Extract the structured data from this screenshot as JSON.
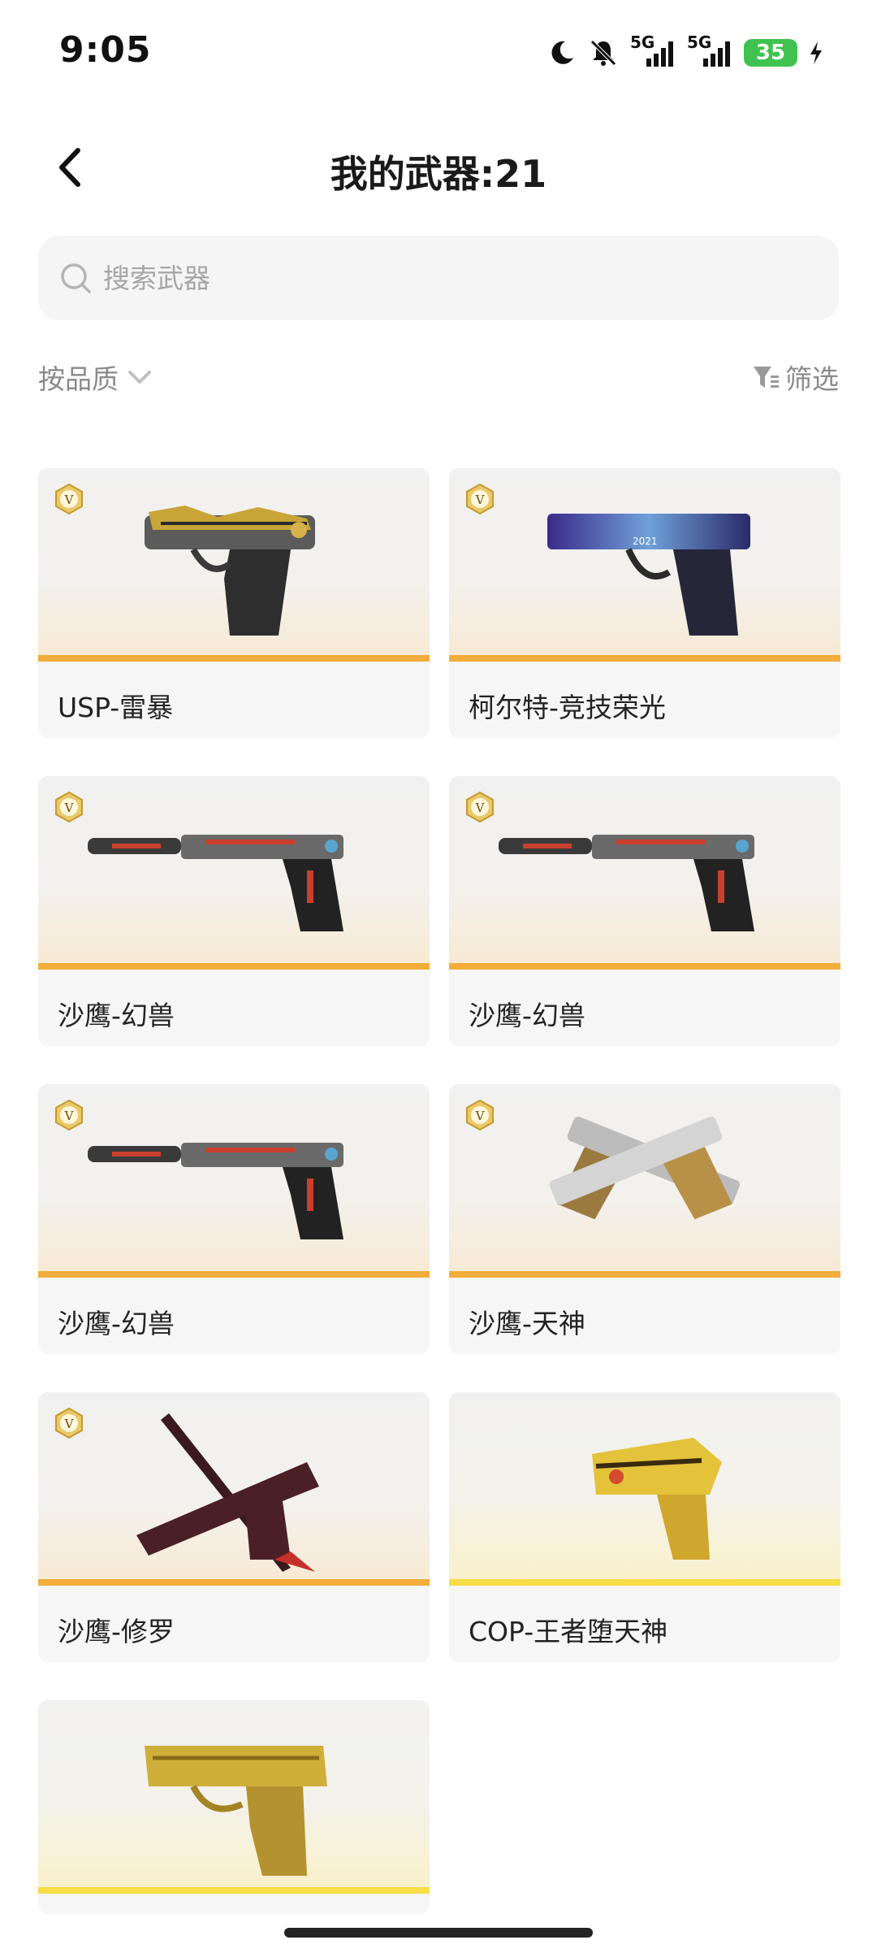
{
  "status_bar": {
    "time": "9:05",
    "net1": "5G",
    "net2": "5G",
    "battery": "35"
  },
  "header": {
    "title": "我的武器:21"
  },
  "search": {
    "placeholder": "搜索武器"
  },
  "toolbar": {
    "sort_label": "按品质",
    "filter_label": "筛选"
  },
  "weapons": [
    {
      "name": "USP-雷暴",
      "badge": "V"
    },
    {
      "name": "柯尔特-竞技荣光",
      "badge": "V",
      "engraving": "2021"
    },
    {
      "name": "沙鹰-幻兽",
      "badge": "V"
    },
    {
      "name": "沙鹰-幻兽",
      "badge": "V"
    },
    {
      "name": "沙鹰-幻兽",
      "badge": "V"
    },
    {
      "name": "沙鹰-天神",
      "badge": "V"
    },
    {
      "name": "沙鹰-修罗",
      "badge": "V"
    },
    {
      "name": "COP-王者堕天神"
    },
    {
      "name": ""
    }
  ],
  "colors": {
    "accent_orange": "#f2ad3a",
    "accent_gold": "#f8dd46",
    "battery_green": "#3fc24f"
  }
}
